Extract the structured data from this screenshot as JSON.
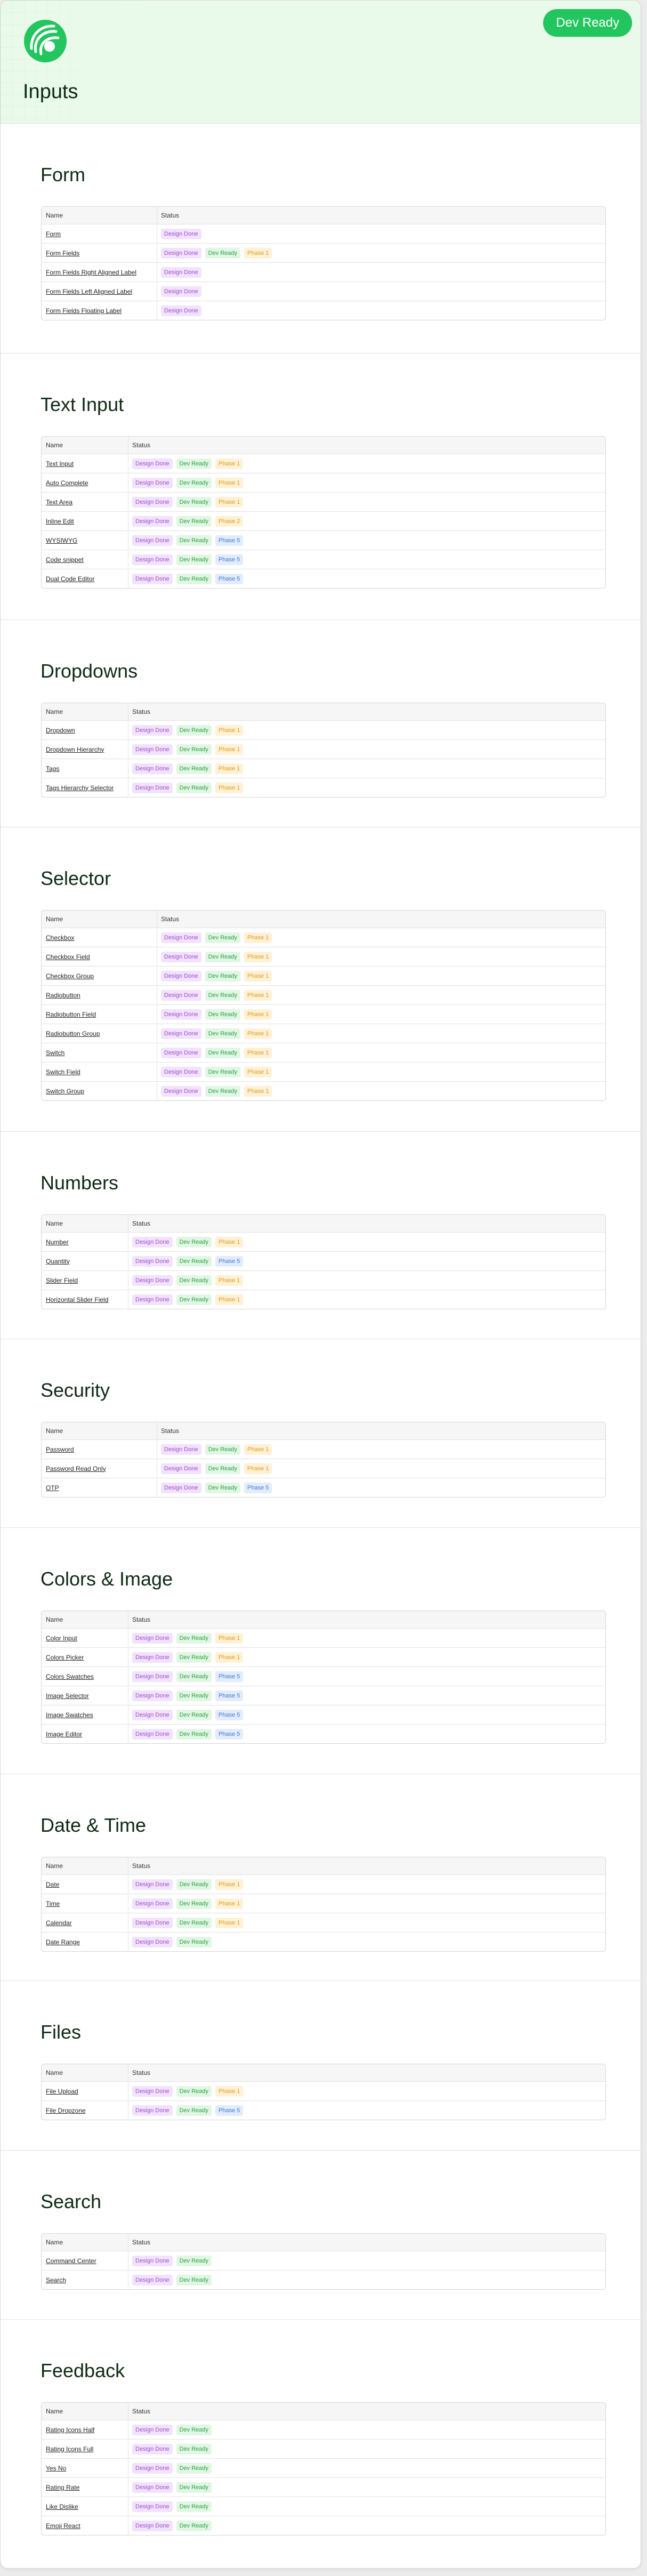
{
  "header": {
    "title": "Inputs",
    "status": "Dev Ready"
  },
  "colors": {
    "accent": "#22c55e",
    "header_bg": "#eafaea"
  },
  "table_headers": {
    "name": "Name",
    "status": "Status"
  },
  "badge_styles": {
    "Design Done": "b-design",
    "Dev Ready": "b-dev",
    "Phase 1": "b-p1",
    "Phase 2": "b-p2",
    "Phase 5": "b-p5"
  },
  "sections": [
    {
      "title": "Form",
      "rows": [
        {
          "name": "Form",
          "badges": [
            "Design Done"
          ]
        },
        {
          "name": "Form Fields",
          "badges": [
            "Design Done",
            "Dev Ready",
            "Phase 1"
          ]
        },
        {
          "name": "Form Fields Right Aligned Label",
          "badges": [
            "Design Done"
          ]
        },
        {
          "name": "Form Fields Left Aligned Label",
          "badges": [
            "Design Done"
          ]
        },
        {
          "name": "Form Fields Floating Label",
          "badges": [
            "Design Done"
          ]
        }
      ]
    },
    {
      "title": "Text Input",
      "rows": [
        {
          "name": "Text Input",
          "badges": [
            "Design Done",
            "Dev Ready",
            "Phase 1"
          ]
        },
        {
          "name": "Auto Complete",
          "badges": [
            "Design Done",
            "Dev Ready",
            "Phase 1"
          ]
        },
        {
          "name": "Text Area",
          "badges": [
            "Design Done",
            "Dev Ready",
            "Phase 1"
          ]
        },
        {
          "name": "Inline Edit",
          "badges": [
            "Design Done",
            "Dev Ready",
            "Phase 2"
          ]
        },
        {
          "name": "WYSIWYG",
          "badges": [
            "Design Done",
            "Dev Ready",
            "Phase 5"
          ]
        },
        {
          "name": "Code snippet",
          "badges": [
            "Design Done",
            "Dev Ready",
            "Phase 5"
          ]
        },
        {
          "name": "Dual Code Editor",
          "badges": [
            "Design Done",
            "Dev Ready",
            "Phase 5"
          ]
        }
      ]
    },
    {
      "title": "Dropdowns",
      "rows": [
        {
          "name": "Dropdown",
          "badges": [
            "Design Done",
            "Dev Ready",
            "Phase 1"
          ]
        },
        {
          "name": "Dropdown Hierarchy",
          "badges": [
            "Design Done",
            "Dev Ready",
            "Phase 1"
          ]
        },
        {
          "name": "Tags",
          "badges": [
            "Design Done",
            "Dev Ready",
            "Phase 1"
          ]
        },
        {
          "name": "Tags Hierarchy Selector",
          "badges": [
            "Design Done",
            "Dev Ready",
            "Phase 1"
          ]
        }
      ]
    },
    {
      "title": "Selector",
      "rows": [
        {
          "name": "Checkbox",
          "badges": [
            "Design Done",
            "Dev Ready",
            "Phase 1"
          ]
        },
        {
          "name": "Checkbox Field",
          "badges": [
            "Design Done",
            "Dev Ready",
            "Phase 1"
          ]
        },
        {
          "name": "Checkbox Group",
          "badges": [
            "Design Done",
            "Dev Ready",
            "Phase 1"
          ]
        },
        {
          "name": "Radiobutton",
          "badges": [
            "Design Done",
            "Dev Ready",
            "Phase 1"
          ]
        },
        {
          "name": "Radiobutton Field",
          "badges": [
            "Design Done",
            "Dev Ready",
            "Phase 1"
          ]
        },
        {
          "name": "Radiobutton Group",
          "badges": [
            "Design Done",
            "Dev Ready",
            "Phase 1"
          ]
        },
        {
          "name": "Switch",
          "badges": [
            "Design Done",
            "Dev Ready",
            "Phase 1"
          ]
        },
        {
          "name": "Switch Field",
          "badges": [
            "Design Done",
            "Dev Ready",
            "Phase 1"
          ]
        },
        {
          "name": "Switch Group",
          "badges": [
            "Design Done",
            "Dev Ready",
            "Phase 1"
          ]
        }
      ]
    },
    {
      "title": "Numbers",
      "rows": [
        {
          "name": "Number",
          "badges": [
            "Design Done",
            "Dev Ready",
            "Phase 1"
          ]
        },
        {
          "name": "Quantity",
          "badges": [
            "Design Done",
            "Dev Ready",
            "Phase 5"
          ]
        },
        {
          "name": "Slider Field",
          "badges": [
            "Design Done",
            "Dev Ready",
            "Phase 1"
          ]
        },
        {
          "name": "Horizontal Slider Field",
          "badges": [
            "Design Done",
            "Dev Ready",
            "Phase 1"
          ]
        }
      ]
    },
    {
      "title": "Security",
      "rows": [
        {
          "name": "Password",
          "badges": [
            "Design Done",
            "Dev Ready",
            "Phase 1"
          ]
        },
        {
          "name": "Password Read Only",
          "badges": [
            "Design Done",
            "Dev Ready",
            "Phase 1"
          ]
        },
        {
          "name": "OTP",
          "badges": [
            "Design Done",
            "Dev Ready",
            "Phase 5"
          ]
        }
      ]
    },
    {
      "title": "Colors & Image",
      "rows": [
        {
          "name": "Color Input",
          "badges": [
            "Design Done",
            "Dev Ready",
            "Phase 1"
          ]
        },
        {
          "name": "Colors Picker",
          "badges": [
            "Design Done",
            "Dev Ready",
            "Phase 1"
          ]
        },
        {
          "name": "Colors Swatches",
          "badges": [
            "Design Done",
            "Dev Ready",
            "Phase 5"
          ]
        },
        {
          "name": "Image Selector",
          "badges": [
            "Design Done",
            "Dev Ready",
            "Phase 5"
          ]
        },
        {
          "name": "Image Swatches",
          "badges": [
            "Design Done",
            "Dev Ready",
            "Phase 5"
          ]
        },
        {
          "name": "Image Editor",
          "badges": [
            "Design Done",
            "Dev Ready",
            "Phase 5"
          ]
        }
      ]
    },
    {
      "title": "Date & Time",
      "rows": [
        {
          "name": "Date",
          "badges": [
            "Design Done",
            "Dev Ready",
            "Phase 1"
          ]
        },
        {
          "name": "Time",
          "badges": [
            "Design Done",
            "Dev Ready",
            "Phase 1"
          ]
        },
        {
          "name": "Calendar",
          "badges": [
            "Design Done",
            "Dev Ready",
            "Phase 1"
          ]
        },
        {
          "name": "Date Range",
          "badges": [
            "Design Done",
            "Dev Ready"
          ]
        }
      ]
    },
    {
      "title": "Files",
      "rows": [
        {
          "name": "File Upload",
          "badges": [
            "Design Done",
            "Dev Ready",
            "Phase 1"
          ]
        },
        {
          "name": "File Dropzone",
          "badges": [
            "Design Done",
            "Dev Ready",
            "Phase 5"
          ]
        }
      ]
    },
    {
      "title": "Search",
      "rows": [
        {
          "name": "Command Center",
          "badges": [
            "Design Done",
            "Dev Ready"
          ]
        },
        {
          "name": "Search",
          "badges": [
            "Design Done",
            "Dev Ready"
          ]
        }
      ]
    },
    {
      "title": "Feedback",
      "rows": [
        {
          "name": "Rating Icons Half",
          "badges": [
            "Design Done",
            "Dev Ready"
          ]
        },
        {
          "name": "Rating Icons Full",
          "badges": [
            "Design Done",
            "Dev Ready"
          ]
        },
        {
          "name": "Yes No",
          "badges": [
            "Design Done",
            "Dev Ready"
          ]
        },
        {
          "name": "Rating Rate",
          "badges": [
            "Design Done",
            "Dev Ready"
          ]
        },
        {
          "name": "Like Dislike",
          "badges": [
            "Design Done",
            "Dev Ready"
          ]
        },
        {
          "name": "Emoji React",
          "badges": [
            "Design Done",
            "Dev Ready"
          ]
        }
      ]
    }
  ]
}
